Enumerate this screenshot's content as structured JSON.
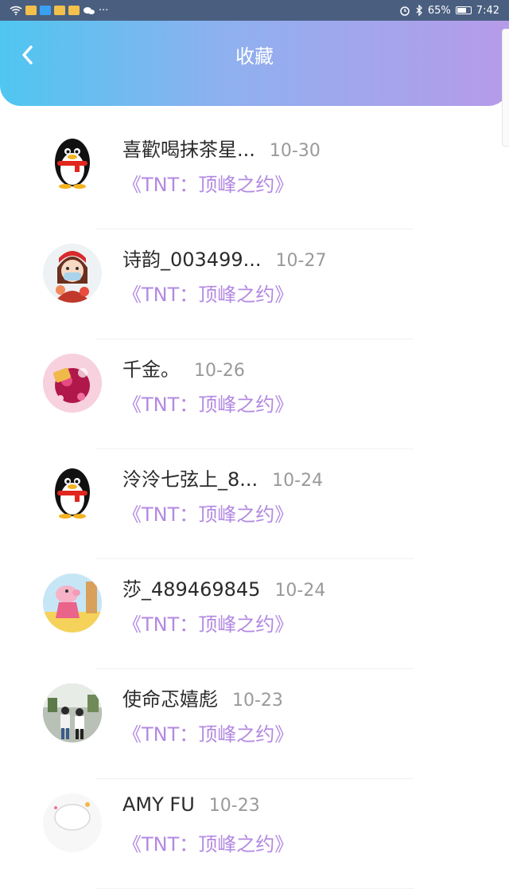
{
  "status_bar": {
    "battery": "65%",
    "time": "7:42",
    "more": "···"
  },
  "header": {
    "title": "收藏"
  },
  "favorites": [
    {
      "name": "喜歡喝抹茶星...",
      "date": "10-30",
      "work": "《TNT：顶峰之约》",
      "avatar": "qq-penguin-avatar"
    },
    {
      "name": "诗韵_003499...",
      "date": "10-27",
      "work": "《TNT：顶峰之约》",
      "avatar": "anime-girl-avatar"
    },
    {
      "name": "千金。",
      "date": "10-26",
      "work": "《TNT：顶峰之约》",
      "avatar": "gift-avatar"
    },
    {
      "name": "泠泠七弦上_8...",
      "date": "10-24",
      "work": "《TNT：顶峰之约》",
      "avatar": "qq-penguin-avatar"
    },
    {
      "name": "莎_489469845",
      "date": "10-24",
      "work": "《TNT：顶峰之约》",
      "avatar": "peppa-avatar"
    },
    {
      "name": "使命忑嬉彪",
      "date": "10-23",
      "work": "《TNT：顶峰之约》",
      "avatar": "photo-avatar"
    },
    {
      "name": "AMY FU",
      "date": "10-23",
      "work": "《TNT：顶峰之约》",
      "avatar": "cartoon-avatar"
    }
  ]
}
